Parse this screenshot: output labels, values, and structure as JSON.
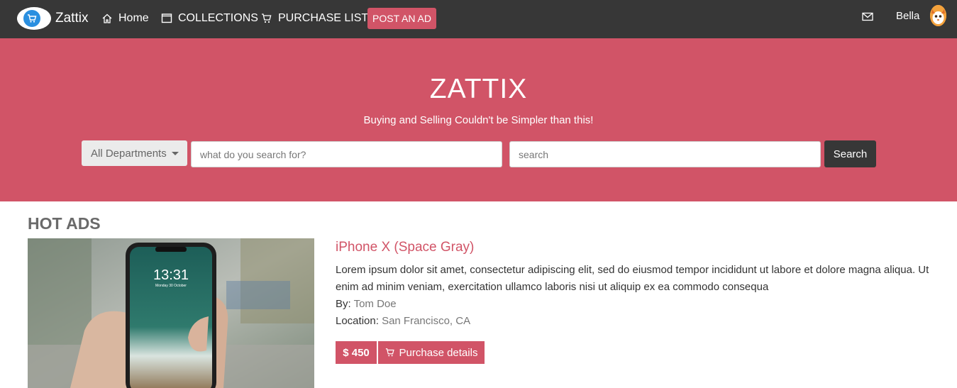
{
  "nav": {
    "brand": "Zattix",
    "home": "Home",
    "collections": "COLLECTIONS",
    "purchase_list": "PURCHASE LIST",
    "post_ad": "POST AN AD",
    "user": "Bella"
  },
  "hero": {
    "title": "ZATTIX",
    "subtitle": "Buying and Selling Couldn't be Simpler than this!",
    "department": "All Departments",
    "query_placeholder": "what do you search for?",
    "location_placeholder": "search",
    "search_button": "Search"
  },
  "hot_ads": {
    "title": "HOT ADS",
    "items": [
      {
        "title": "iPhone X (Space Gray)",
        "description": "Lorem ipsum dolor sit amet, consectetur adipiscing elit, sed do eiusmod tempor incididunt ut labore et dolore magna aliqua. Ut enim ad minim veniam, exercitation ullamco laboris nisi ut aliquip ex ea commodo consequa",
        "by_label": "By:",
        "by": "Tom Doe",
        "location_label": "Location:",
        "location": "San Francisco, CA",
        "price": "$ 450",
        "details_button": "Purchase details",
        "phone_time": "13:31",
        "phone_date": "Monday 30 October"
      }
    ]
  },
  "colors": {
    "navbar": "#373737",
    "accent": "#d15467",
    "hero": "#d15467"
  },
  "icons": [
    "cart-icon",
    "home-icon",
    "tablet-icon",
    "mail-icon",
    "avatar-icon",
    "caret-down-icon"
  ]
}
